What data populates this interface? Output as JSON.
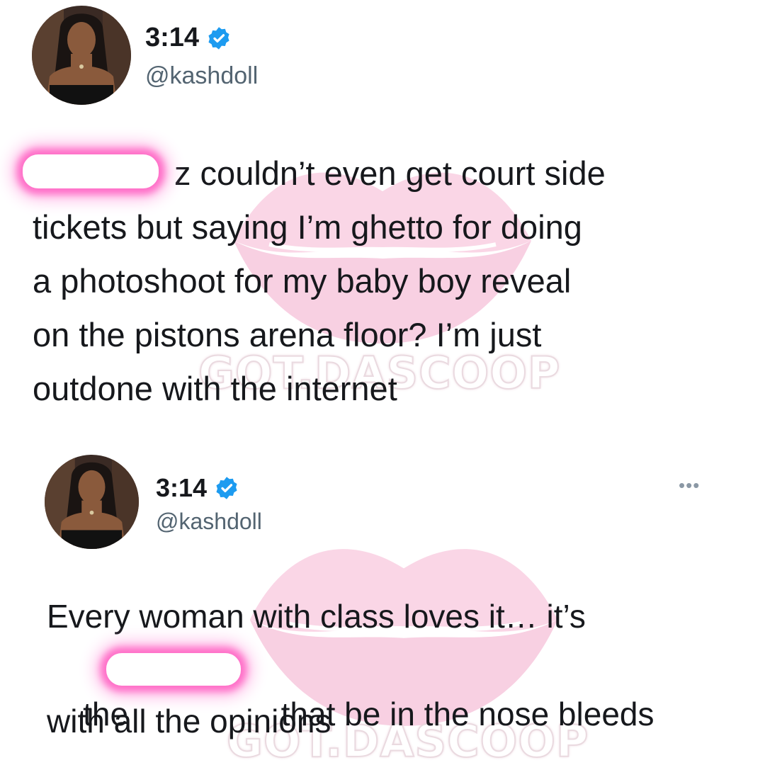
{
  "tweets": [
    {
      "time": "3:14",
      "handle": "@kashdoll",
      "text": "z couldn’t even get court side\ntickets but saying I’m ghetto for doing\na photoshoot for my baby boy reveal\non the pistons arena floor? I’m just\noutdone with the internet",
      "verified_color": "#1d9bf0",
      "verified_icon": "verified-badge-icon",
      "avatar_icon": "profile-photo"
    },
    {
      "time": "3:14",
      "handle": "@kashdoll",
      "text_line1": "Every woman with class loves it… it’s",
      "text_line2_start": "the ",
      "text_line2_end": " that be in the nose bleeds",
      "text_line3": "with all the opinions",
      "more_icon": "•••",
      "verified_color": "#1d9bf0",
      "verified_icon": "verified-badge-icon",
      "avatar_icon": "profile-photo"
    }
  ],
  "watermark": {
    "text": "GOT.DASCOOP",
    "icon": "lips-icon",
    "color": "#f6b6d3"
  },
  "censor_color": "#ff6fc8"
}
